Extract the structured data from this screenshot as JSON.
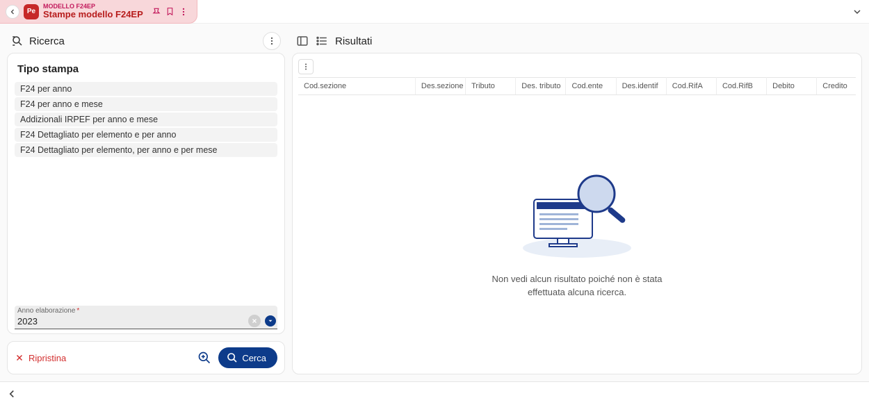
{
  "tab": {
    "subtitle": "MODELLO F24EP",
    "title": "Stampe modello F24EP",
    "logo_text": "Pe"
  },
  "left": {
    "title": "Ricerca",
    "box_title": "Tipo stampa",
    "options": [
      "F24 per anno",
      "F24 per anno e mese",
      "Addizionali IRPEF per anno e mese",
      "F24 Dettagliato per elemento e per anno",
      "F24 Dettagliato per elemento, per anno e per mese"
    ],
    "field_label": "Anno elaborazione",
    "field_required": "*",
    "field_value": "2023",
    "reset_label": "Ripristina",
    "search_label": "Cerca"
  },
  "right": {
    "title": "Risultati",
    "columns": [
      "Cod.sezione",
      "Des.sezione",
      "Tributo",
      "Des. tributo",
      "Cod.ente",
      "Des.identif",
      "Cod.RifA",
      "Cod.RifB",
      "Debito",
      "Credito"
    ],
    "empty_line1": "Non vedi alcun risultato poiché non è stata",
    "empty_line2": "effettuata alcuna ricerca."
  }
}
